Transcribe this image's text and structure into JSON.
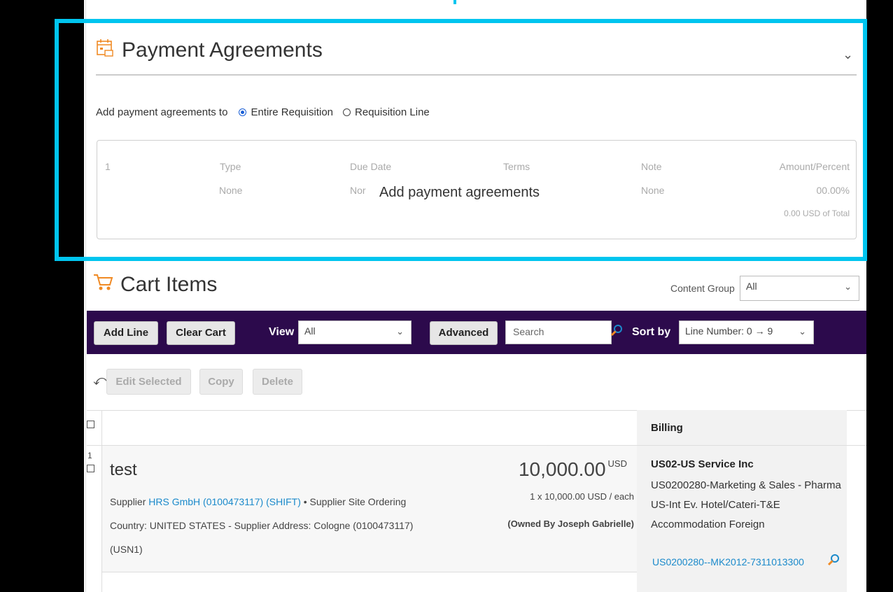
{
  "payment_agreements": {
    "title": "Payment Agreements",
    "add_to_label": "Add payment agreements to",
    "options": [
      "Entire Requisition",
      "Requisition Line"
    ],
    "selected_option": "Entire Requisition",
    "row": {
      "number": "1",
      "type_header": "Type",
      "type_value": "None",
      "due_date_header": "Due Date",
      "due_date_value": "Nor",
      "terms_header": "Terms",
      "note_header": "Note",
      "note_value": "None",
      "amount_header": "Amount/Percent",
      "amount_value": "00.00%",
      "amount_total": "0.00 USD of Total"
    },
    "overlay_label": "Add payment agreements"
  },
  "cart_items": {
    "title": "Cart Items",
    "content_group_label": "Content Group",
    "content_group_value": "All",
    "toolbar": {
      "add_line": "Add Line",
      "clear_cart": "Clear Cart",
      "view_label": "View",
      "view_value": "All",
      "advanced": "Advanced",
      "search_placeholder": "Search",
      "sort_by_label": "Sort by",
      "sort_by_value": "Line Number: 0 → 9"
    },
    "actions": {
      "edit_selected": "Edit Selected",
      "copy": "Copy",
      "delete": "Delete"
    },
    "billing_header": "Billing",
    "line": {
      "number": "1",
      "name": "test",
      "price": "10,000.00",
      "currency": "USD",
      "unit_line": "1 x 10,000.00 USD / each",
      "owner": "(Owned By Joseph Gabrielle)",
      "supplier_label": "Supplier",
      "supplier_link": "HRS GmbH (0100473117) (SHIFT)",
      "supplier_suffix": "• Supplier Site Ordering",
      "country_line": "Country: UNITED STATES - Supplier Address: Cologne (0100473117)",
      "country_line2": "(USN1)",
      "billing_entity": "US02-US Service Inc",
      "billing_text": "US0200280-Marketing & Sales - Pharma US-Int Ev. Hotel/Cateri-T&E Accommodation Foreign",
      "billing_code": "US0200280--MK2012-7311013300"
    }
  },
  "colors": {
    "highlight": "#00c5ef",
    "toolbar_bg": "#2c0a4c",
    "link": "#1b8acb",
    "icon_orange": "#f08a24"
  }
}
